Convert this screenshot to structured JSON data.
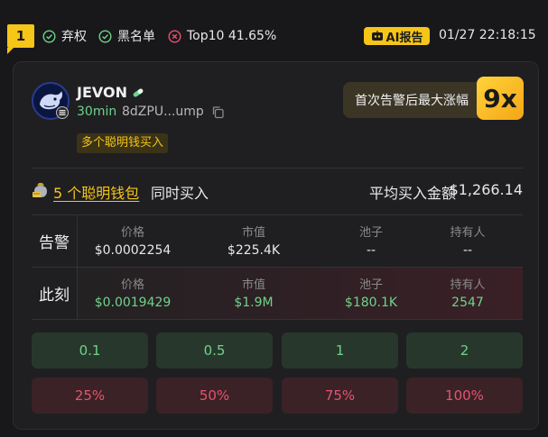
{
  "header": {
    "rank": "1",
    "tags": [
      {
        "label": "弃权",
        "icon": "check-circle-icon"
      },
      {
        "label": "黑名单",
        "icon": "check-circle-icon"
      },
      {
        "label": "Top10 41.65%",
        "icon": "x-circle-icon"
      }
    ],
    "ai_report_label": "AI报告",
    "timestamp": "01/27 22:18:15"
  },
  "token": {
    "name": "JEVON",
    "age": "30min",
    "address": "8dZPU...ump",
    "tag": "多个聪明钱买入"
  },
  "gain": {
    "label": "首次告警后最大涨幅",
    "value": "9x"
  },
  "summary": {
    "smart_wallets": "5 个聪明钱包",
    "suffix": "同时买入",
    "avg_label": "平均买入金额",
    "avg_value": "$1,266.14"
  },
  "table": {
    "headers": [
      "价格",
      "市值",
      "池子",
      "持有人"
    ],
    "rows": [
      {
        "label": "告警",
        "values": [
          "$0.0002254",
          "$225.4K",
          "--",
          "--"
        ]
      },
      {
        "label": "此刻",
        "values": [
          "$0.0019429",
          "$1.9M",
          "$180.1K",
          "2547"
        ]
      }
    ]
  },
  "buy_buttons": [
    "0.1",
    "0.5",
    "1",
    "2"
  ],
  "sell_buttons": [
    "25%",
    "50%",
    "75%",
    "100%"
  ],
  "colors": {
    "accent": "#f5c518",
    "green": "#6fd38a",
    "red": "#e5546d"
  }
}
